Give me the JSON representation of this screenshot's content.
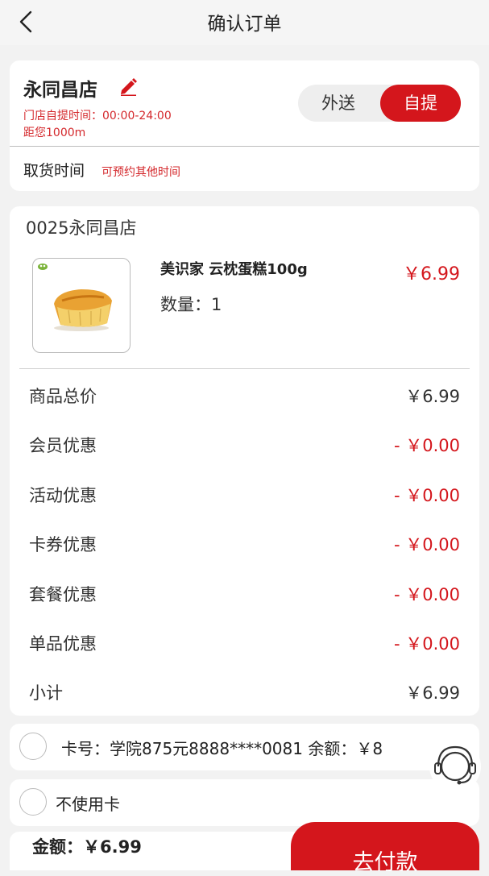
{
  "header": {
    "title": "确认订单"
  },
  "store": {
    "name": "永同昌店",
    "hours": "门店自提时间：00:00-24:00",
    "distance": "距您1000m",
    "toggle": {
      "delivery": "外送",
      "pickup": "自提",
      "selected": "pickup"
    },
    "pickup_time_label": "取货时间",
    "pickup_time_hint": "可预约其他时间"
  },
  "order": {
    "store_code": "0025永同昌店",
    "product": {
      "name": "美识家 云枕蛋糕100g",
      "quantity": "数量：1",
      "price": "￥6.99"
    },
    "summary": [
      {
        "label": "商品总价",
        "value": "￥6.99",
        "discount": false
      },
      {
        "label": "会员优惠",
        "value": "- ￥0.00",
        "discount": true
      },
      {
        "label": "活动优惠",
        "value": "- ￥0.00",
        "discount": true
      },
      {
        "label": "卡券优惠",
        "value": "- ￥0.00",
        "discount": true
      },
      {
        "label": "套餐优惠",
        "value": "- ￥0.00",
        "discount": true
      },
      {
        "label": "单品优惠",
        "value": "- ￥0.00",
        "discount": true
      },
      {
        "label": "小计",
        "value": "￥6.99",
        "discount": false
      }
    ]
  },
  "payment": {
    "card_option": "卡号：学院875元8888****0081 余额：￥8",
    "no_card_option": "不使用卡"
  },
  "footer": {
    "amount": "金额：￥6.99",
    "pay_button": "去付款"
  },
  "colors": {
    "accent": "#d4161c",
    "background": "#f2f2f2"
  }
}
